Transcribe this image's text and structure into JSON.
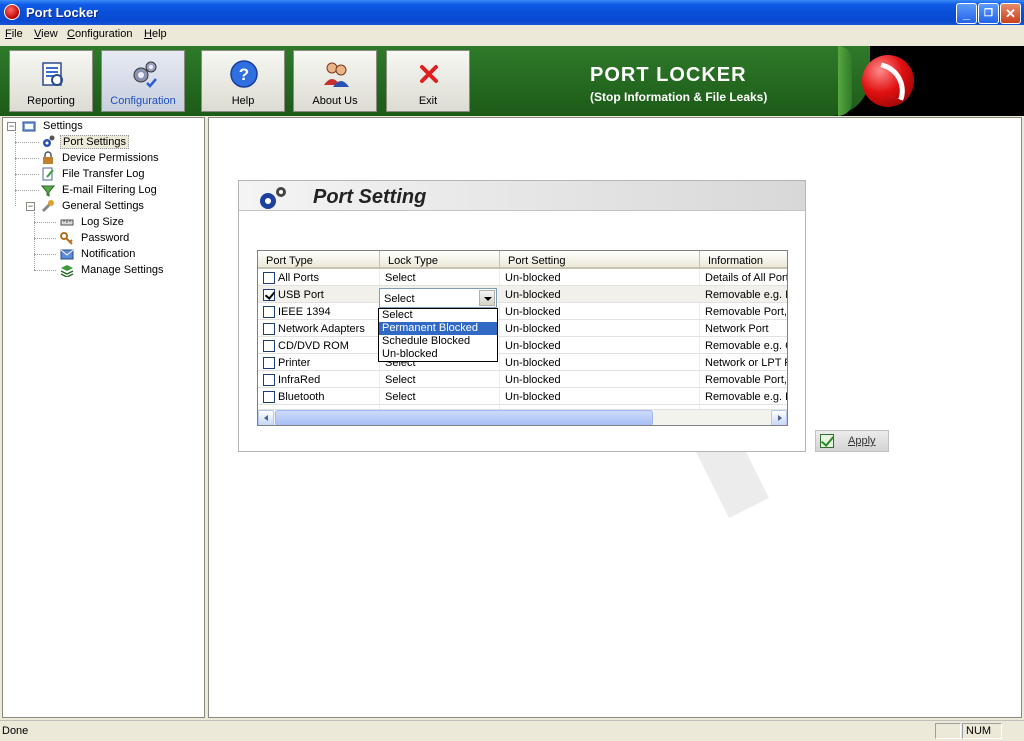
{
  "window": {
    "title": "Port Locker"
  },
  "menu": [
    "File",
    "View",
    "Configuration",
    "Help"
  ],
  "toolbar": {
    "buttons": [
      "Reporting",
      "Configuration",
      "Help",
      "About Us",
      "Exit"
    ],
    "active": "Configuration",
    "brand_title": "PORT LOCKER",
    "brand_subtitle": "(Stop Information & File Leaks)"
  },
  "tree": {
    "root": "Settings",
    "items": [
      "Port Settings",
      "Device Permissions",
      "File Transfer Log",
      "E-mail Filtering Log",
      "General Settings"
    ],
    "general_children": [
      "Log Size",
      "Password",
      "Notification",
      "Manage Settings"
    ],
    "selected": "Port Settings"
  },
  "panel": {
    "title": "Port Setting",
    "columns": [
      "Port Type",
      "Lock Type",
      "Port Setting",
      "Information"
    ],
    "rows": [
      {
        "checked": false,
        "port": "All Ports",
        "lock": "Select",
        "setting": "Un-blocked",
        "info": "Details of All Ports"
      },
      {
        "checked": true,
        "port": "USB Port",
        "lock": "Select",
        "setting": "Un-blocked",
        "info": "Removable e.g. M"
      },
      {
        "checked": false,
        "port": "IEEE 1394",
        "lock": "Select",
        "setting": "Un-blocked",
        "info": "Removable Port,"
      },
      {
        "checked": false,
        "port": "Network Adapters",
        "lock": "Select",
        "setting": "Un-blocked",
        "info": "Network Port"
      },
      {
        "checked": false,
        "port": "CD/DVD ROM",
        "lock": "Select",
        "setting": "Un-blocked",
        "info": "Removable e.g. C"
      },
      {
        "checked": false,
        "port": "Printer",
        "lock": "Select",
        "setting": "Un-blocked",
        "info": "Network or LPT P"
      },
      {
        "checked": false,
        "port": "InfraRed",
        "lock": "Select",
        "setting": "Un-blocked",
        "info": "Removable Port,"
      },
      {
        "checked": false,
        "port": "Bluetooth",
        "lock": "Select",
        "setting": "Un-blocked",
        "info": "Removable e.g. E"
      }
    ],
    "combo_value": "Select",
    "dropdown_options": [
      "Select",
      "Permanent Blocked",
      "Schedule Blocked",
      "Un-blocked"
    ],
    "dropdown_highlight": "Permanent Blocked",
    "apply_label": "Apply"
  },
  "status": {
    "text": "Done",
    "num": "NUM"
  }
}
